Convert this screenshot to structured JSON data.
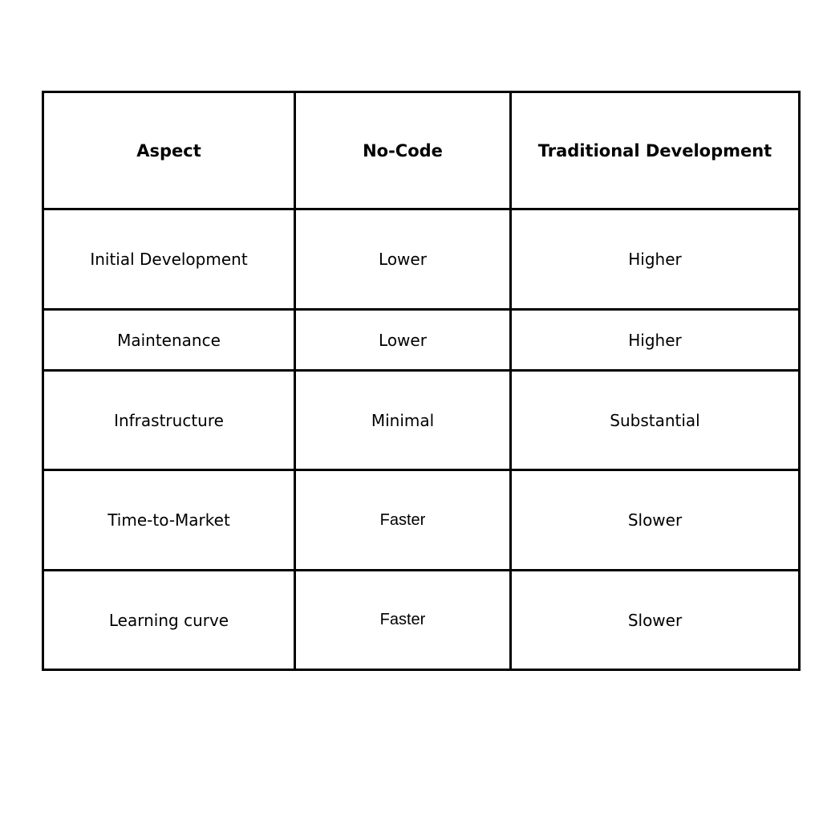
{
  "table": {
    "headers": [
      "Aspect",
      "No-Code",
      "Traditional Development"
    ],
    "rows": [
      [
        "Initial Development",
        "Lower",
        "Higher"
      ],
      [
        "Maintenance",
        "Lower",
        "Higher"
      ],
      [
        "Infrastructure",
        "Minimal",
        "Substantial"
      ],
      [
        "Time-to-Market",
        "Faster",
        "Slower"
      ],
      [
        "Learning curve",
        "Faster",
        "Slower"
      ]
    ]
  }
}
